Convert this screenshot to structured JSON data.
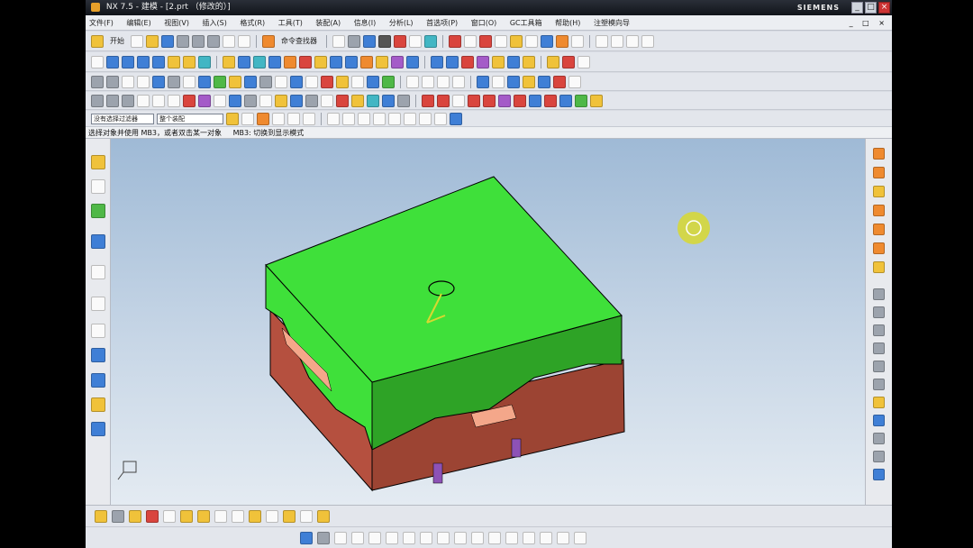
{
  "window": {
    "title": "NX 7.5 - 建模 - [2.prt （修改的）]",
    "brand": "SIEMENS",
    "buttons": [
      "_",
      "□",
      "×"
    ]
  },
  "menubar": {
    "items": [
      "文件(F)",
      "编辑(E)",
      "视图(V)",
      "插入(S)",
      "格式(R)",
      "工具(T)",
      "装配(A)",
      "信息(I)",
      "分析(L)",
      "首选项(P)",
      "窗口(O)",
      "GC工具箱",
      "帮助(H)",
      "注塑模向导"
    ],
    "mdi_controls": "_ □ ×"
  },
  "toolbar": {
    "start_label": "开始",
    "command_finder_label": "命令查找器",
    "filter_combo": "没有选择过滤器",
    "assembly_combo": "整个装配"
  },
  "cue_line": {
    "prompt": "选择对象并使用 MB3，或者双击某一对象",
    "status": "MB3: 切换到显示模式"
  },
  "icons": {
    "left_resource_bar": [
      "assembly-navigator-icon",
      "part-navigator-icon",
      "reuse-library-icon",
      "web-browser-icon",
      "history-icon",
      "system-materials-icon",
      "process-studio-icon",
      "roles-icon",
      "system-scene-icon"
    ],
    "right_mold_wizard_bar": [
      "mold-wizard-init-icon",
      "mold-csys-icon",
      "shrinkage-icon",
      "workpiece-icon",
      "layout-icon",
      "mold-tools-icon",
      "parting-icon",
      "mold-base-icon",
      "standard-parts-icon",
      "ejector-pin-icon",
      "slider-lifter-icon",
      "sub-insert-icon",
      "gate-icon",
      "runner-icon",
      "cooling-icon",
      "electrode-icon",
      "bom-icon",
      "drawing-icon"
    ]
  },
  "colors": {
    "top_plate": "#3fe03a",
    "top_plate_side": "#2ea326",
    "bottom_plate": "#b5503f",
    "bottom_plate_side": "#9c4433",
    "insert_highlight": "#f4a78a",
    "guide_pin": "#8d52b6",
    "viewport_top": "#9fbad6",
    "viewport_bottom": "#e4ebf2",
    "rotate_cursor": "#d8d830"
  }
}
